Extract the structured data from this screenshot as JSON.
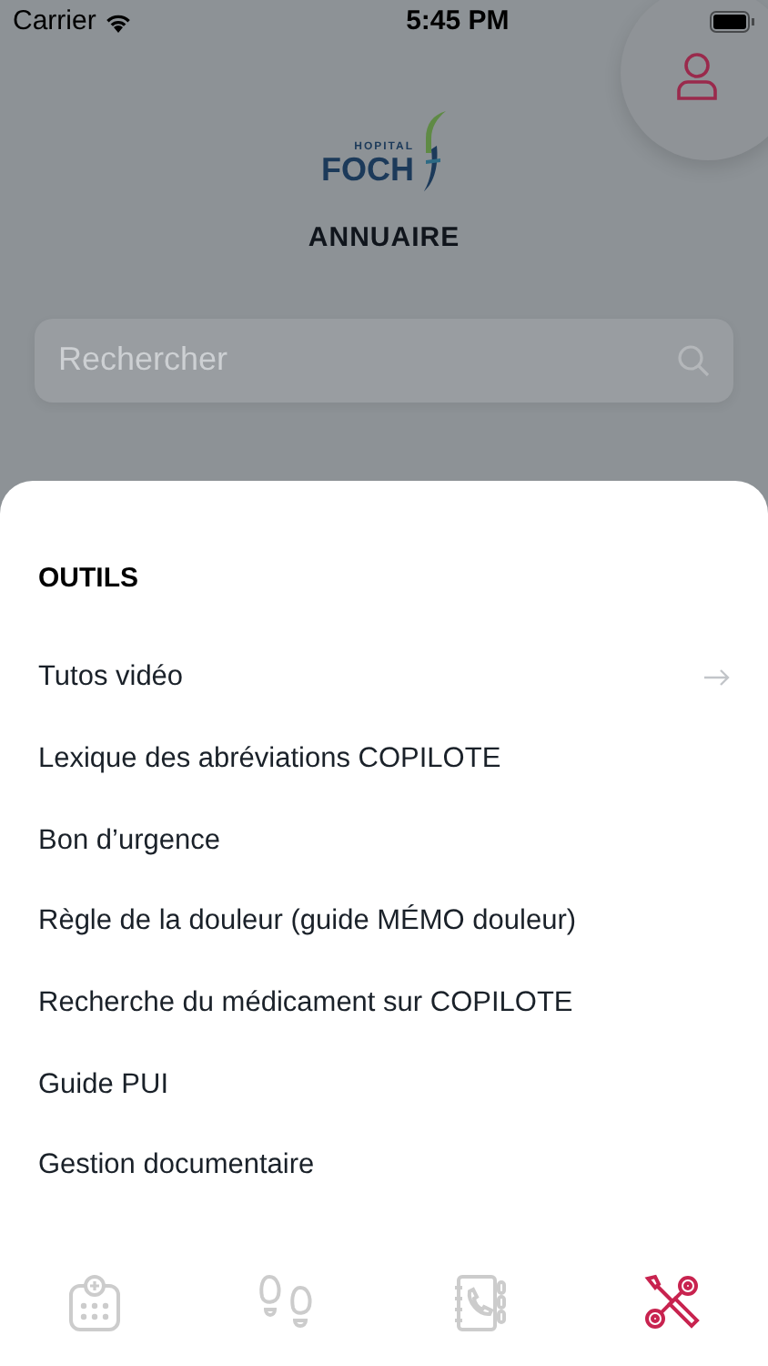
{
  "status_bar": {
    "carrier": "Carrier",
    "time": "5:45 PM"
  },
  "logo": {
    "small": "HOPITAL",
    "big": "FOCH"
  },
  "title": "ANNUAIRE",
  "search": {
    "placeholder": "Rechercher"
  },
  "sheet": {
    "title": "OUTILS",
    "items": [
      {
        "label": "Tutos vidéo",
        "has_arrow": true
      },
      {
        "label": "Lexique des abréviations COPILOTE",
        "has_arrow": false
      },
      {
        "label": "Bon d’urgence",
        "has_arrow": false
      },
      {
        "label": "Règle de la douleur (guide MÉMO douleur)",
        "has_arrow": false
      },
      {
        "label": "Recherche du médicament sur COPILOTE",
        "has_arrow": false
      },
      {
        "label": "Guide PUI",
        "has_arrow": false
      },
      {
        "label": "Gestion documentaire",
        "has_arrow": false
      }
    ]
  },
  "tabs": [
    {
      "kind": "calendar",
      "selected": false
    },
    {
      "kind": "footprints",
      "selected": false
    },
    {
      "kind": "phonebook",
      "selected": false
    },
    {
      "kind": "tools",
      "selected": true
    }
  ]
}
